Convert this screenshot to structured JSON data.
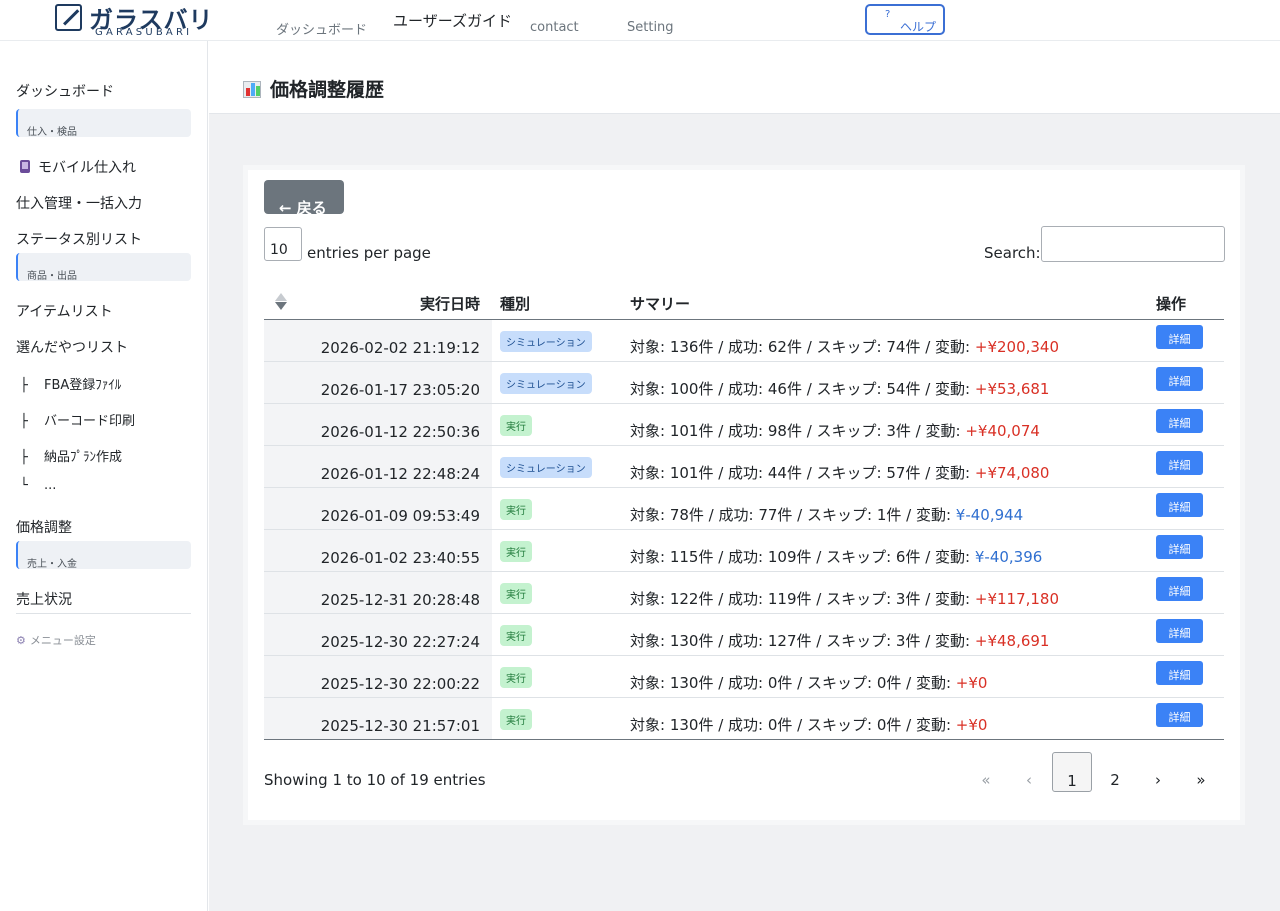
{
  "brand": {
    "name": "ガラスバリ",
    "sub": "GARASUBARI"
  },
  "topnav": {
    "items": [
      "ダッシュボード",
      "ユーザーズガイド",
      "contact",
      "Setting"
    ],
    "help_icon": "?",
    "help_label": "ヘルプ"
  },
  "sidebar": {
    "dashboard": "ダッシュボード",
    "section_purchase": "仕入・検品",
    "mobile": "モバイル仕入れ",
    "purchase_mgmt": "仕入管理・一括入力",
    "status_list": "ステータス別リスト",
    "section_goods": "商品・出品",
    "item_list": "アイテムリスト",
    "picked_list": "選んだやつリスト",
    "fba": "FBA登録ﾌｧｲﾙ",
    "barcode": "バーコード印刷",
    "plan": "納品ﾌﾟﾗﾝ作成",
    "more": "...",
    "price_adjust": "価格調整",
    "section_sales": "売上・入金",
    "sales_status": "売上状況",
    "menu_settings": "メニュー設定",
    "tree_branch": "├",
    "tree_end": "└"
  },
  "page": {
    "title": "価格調整履歴",
    "icon": "bar-chart-icon"
  },
  "controls": {
    "back": "← 戻る",
    "entries_value": "10",
    "entries_label": "entries per page",
    "search_label": "Search:",
    "search_value": ""
  },
  "table": {
    "headers": {
      "date": "実行日時",
      "type": "種別",
      "summary": "サマリー",
      "ops": "操作"
    },
    "detail_label": "詳細",
    "rows": [
      {
        "date": "2026-02-02 21:19:12",
        "type": "シミュレーション",
        "kind": "sim",
        "summary": "対象: 136件 / 成功: 62件 / スキップ: 74件 / 変動: ",
        "change": "+¥200,340",
        "sign": "pos"
      },
      {
        "date": "2026-01-17 23:05:20",
        "type": "シミュレーション",
        "kind": "sim",
        "summary": "対象: 100件 / 成功: 46件 / スキップ: 54件 / 変動: ",
        "change": "+¥53,681",
        "sign": "pos"
      },
      {
        "date": "2026-01-12 22:50:36",
        "type": "実行",
        "kind": "exec",
        "summary": "対象: 101件 / 成功: 98件 / スキップ: 3件 / 変動: ",
        "change": "+¥40,074",
        "sign": "pos"
      },
      {
        "date": "2026-01-12 22:48:24",
        "type": "シミュレーション",
        "kind": "sim",
        "summary": "対象: 101件 / 成功: 44件 / スキップ: 57件 / 変動: ",
        "change": "+¥74,080",
        "sign": "pos"
      },
      {
        "date": "2026-01-09 09:53:49",
        "type": "実行",
        "kind": "exec",
        "summary": "対象: 78件 / 成功: 77件 / スキップ: 1件 / 変動: ",
        "change": "¥-40,944",
        "sign": "neg"
      },
      {
        "date": "2026-01-02 23:40:55",
        "type": "実行",
        "kind": "exec",
        "summary": "対象: 115件 / 成功: 109件 / スキップ: 6件 / 変動: ",
        "change": "¥-40,396",
        "sign": "neg"
      },
      {
        "date": "2025-12-31 20:28:48",
        "type": "実行",
        "kind": "exec",
        "summary": "対象: 122件 / 成功: 119件 / スキップ: 3件 / 変動: ",
        "change": "+¥117,180",
        "sign": "pos"
      },
      {
        "date": "2025-12-30 22:27:24",
        "type": "実行",
        "kind": "exec",
        "summary": "対象: 130件 / 成功: 127件 / スキップ: 3件 / 変動: ",
        "change": "+¥48,691",
        "sign": "pos"
      },
      {
        "date": "2025-12-30 22:00:22",
        "type": "実行",
        "kind": "exec",
        "summary": "対象: 130件 / 成功: 0件 / スキップ: 0件 / 変動: ",
        "change": "+¥0",
        "sign": "pos"
      },
      {
        "date": "2025-12-30 21:57:01",
        "type": "実行",
        "kind": "exec",
        "summary": "対象: 130件 / 成功: 0件 / スキップ: 0件 / 変動: ",
        "change": "+¥0",
        "sign": "pos"
      }
    ]
  },
  "footer": {
    "showing": "Showing 1 to 10 of 19 entries",
    "pager": {
      "first": "«",
      "prev": "‹",
      "pages": [
        "1",
        "2"
      ],
      "current": "1",
      "next": "›",
      "last": "»"
    }
  },
  "colors": {
    "accent": "#3b82f6",
    "positive": "#d93025",
    "negative": "#2f6fd0",
    "sim_badge": "#c7ddfb",
    "exec_badge": "#c4f2cf"
  }
}
